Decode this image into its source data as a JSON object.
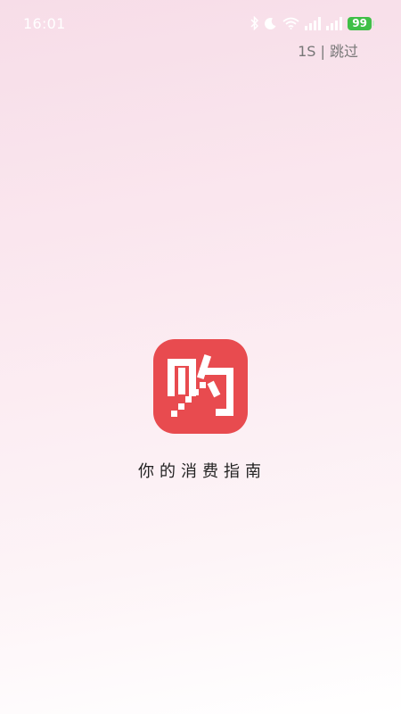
{
  "status_bar": {
    "time": "16:01",
    "battery": "99",
    "icons": [
      "bluetooth-icon",
      "moon-icon",
      "wifi-icon",
      "signal-icon",
      "signal-icon",
      "battery-icon"
    ]
  },
  "skip": {
    "countdown": "1S",
    "separator": " | ",
    "label": "跳过"
  },
  "logo": {
    "glyph_semantic": "shopping-logo-icon",
    "background_color": "#e84b4f"
  },
  "slogan": "你的消费指南"
}
